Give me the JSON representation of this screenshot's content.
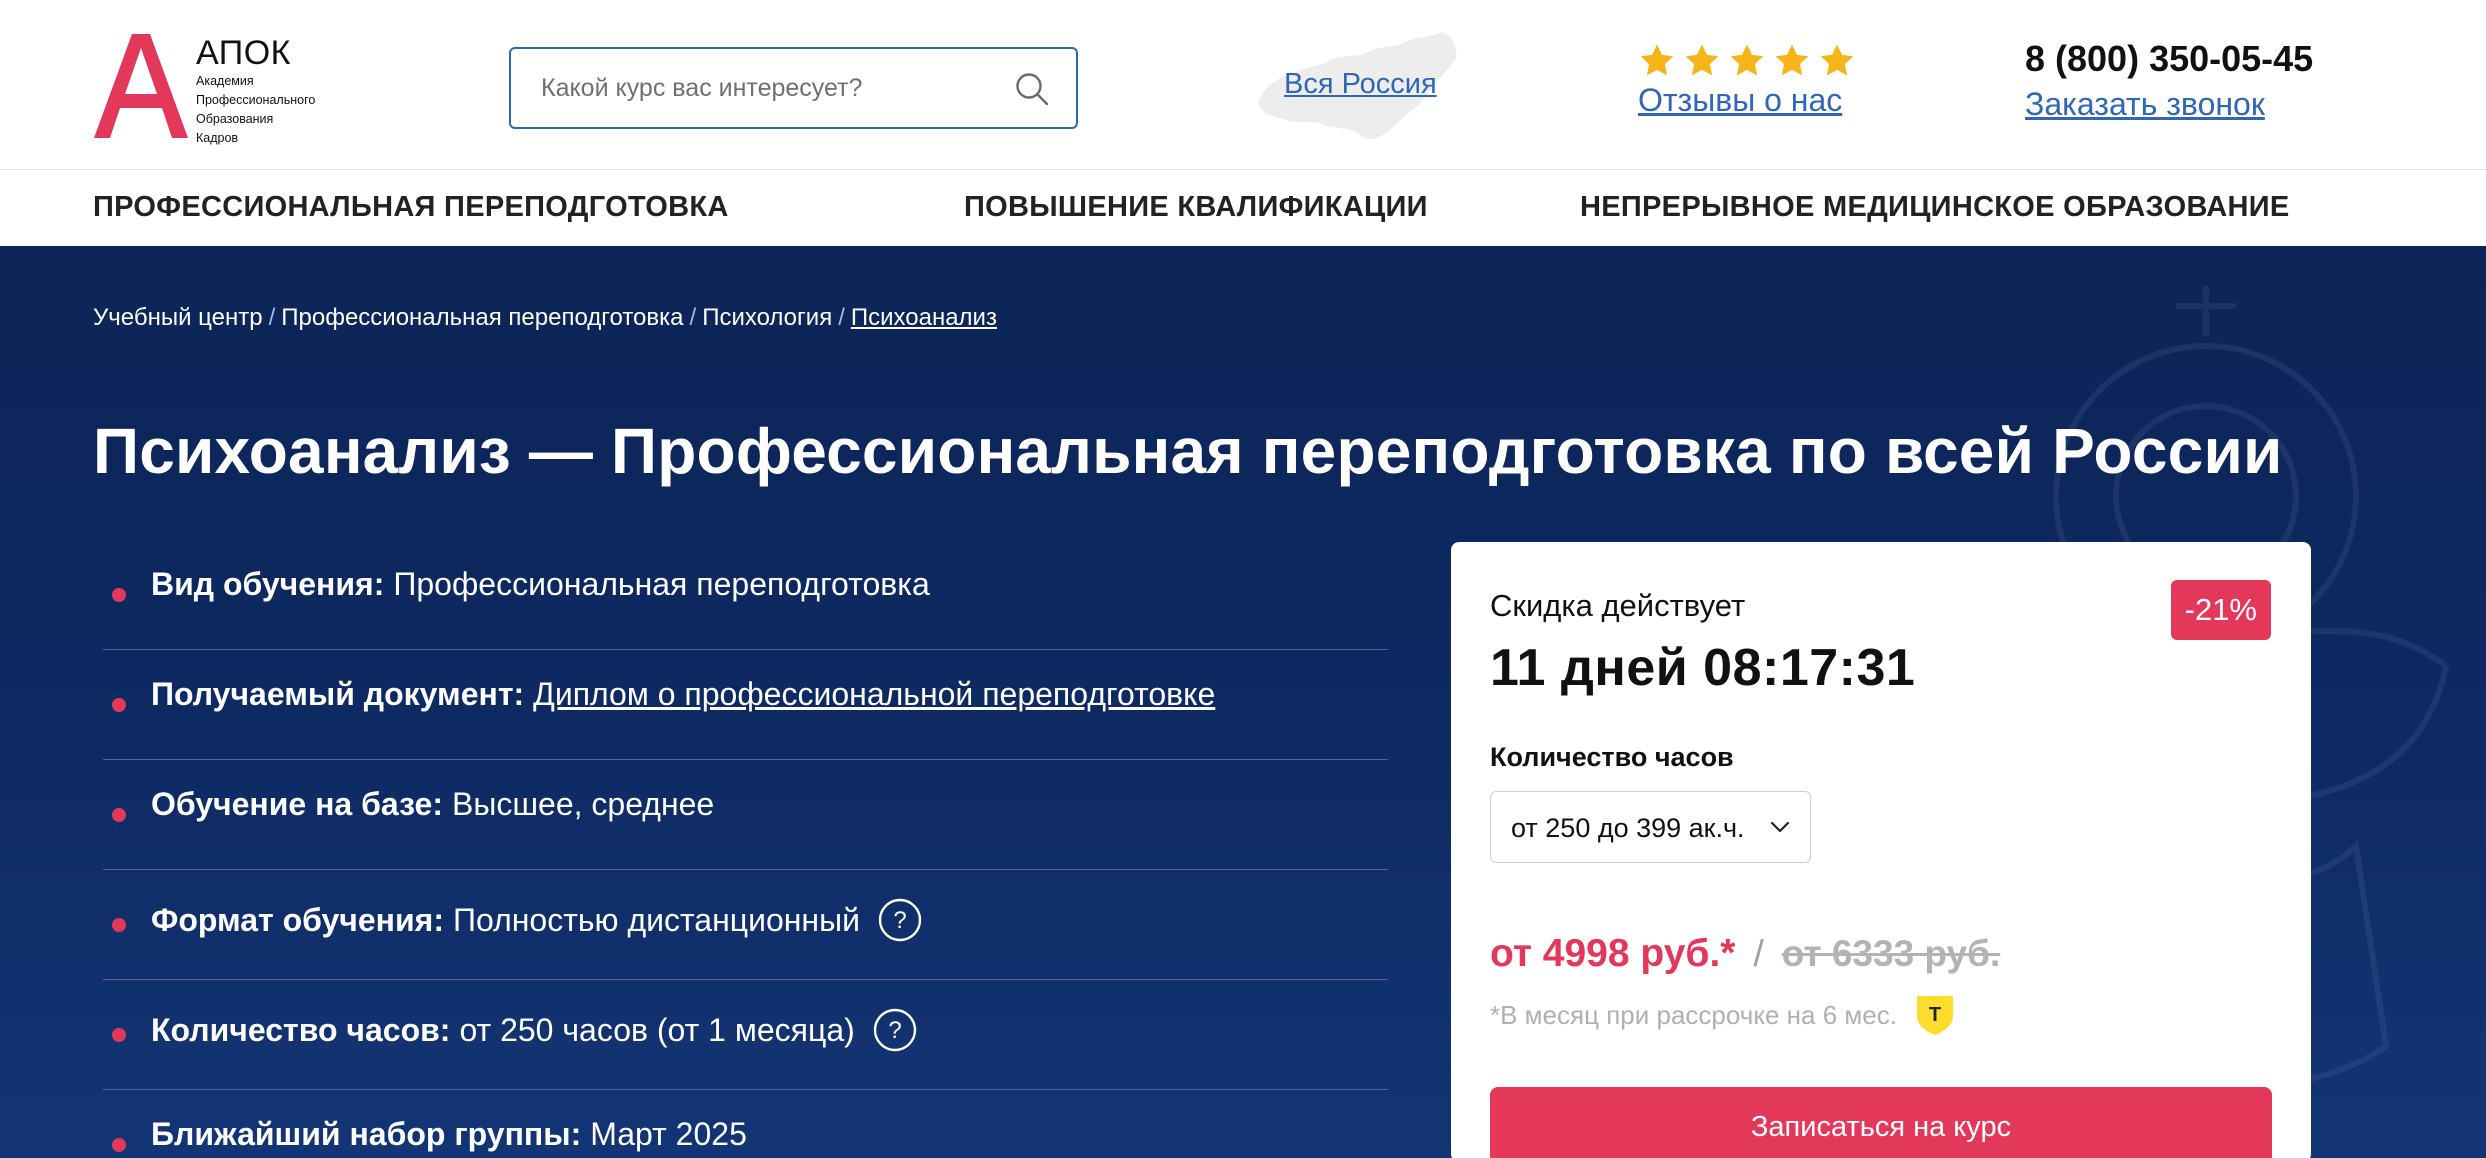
{
  "brand": {
    "name": "АПОК",
    "subtitle_lines": [
      "Академия",
      "Профессионального",
      "Образования",
      "Кадров"
    ],
    "accent_color": "#e3385a",
    "link_color": "#2f66b8"
  },
  "search": {
    "placeholder": "Какой курс вас интересует?",
    "value": ""
  },
  "region": {
    "label": "Вся Россия"
  },
  "reviews": {
    "rating_stars": 5,
    "label": "Отзывы о нас"
  },
  "contacts": {
    "phone": "8 (800) 350-05-45",
    "callback_label": "Заказать звонок"
  },
  "nav": {
    "items": [
      {
        "label": "ПРОФЕССИОНАЛЬНАЯ ПЕРЕПОДГОТОВКА"
      },
      {
        "label": "ПОВЫШЕНИЕ КВАЛИФИКАЦИИ"
      },
      {
        "label": "НЕПРЕРЫВНОЕ МЕДИЦИНСКОЕ ОБРАЗОВАНИЕ"
      }
    ]
  },
  "breadcrumb": {
    "items": [
      "Учебный центр",
      "Профессиональная переподготовка",
      "Психология",
      "Психоанализ"
    ],
    "separator": "/"
  },
  "page": {
    "title": "Психоанализ — Профессиональная переподготовка по всей России"
  },
  "facts": [
    {
      "label": "Вид обучения:",
      "value": "Профессиональная переподготовка",
      "link": false,
      "help": false
    },
    {
      "label": "Получаемый документ:",
      "value": "Диплом о профессиональной переподготовке",
      "link": true,
      "help": false
    },
    {
      "label": "Обучение на базе:",
      "value": "Высшее, среднее",
      "link": false,
      "help": false
    },
    {
      "label": "Формат обучения:",
      "value": "Полностью дистанционный",
      "link": false,
      "help": true
    },
    {
      "label": "Количество часов:",
      "value": "от 250 часов (от 1 месяца)",
      "link": false,
      "help": true
    },
    {
      "label": "Ближайший набор группы:",
      "value": "Март 2025",
      "link": false,
      "help": false
    }
  ],
  "help_icon_glyph": "?",
  "price_card": {
    "discount_label": "Скидка действует",
    "timer": "11 дней 08:17:31",
    "discount_badge": "-21%",
    "hours_label": "Количество часов",
    "hours_selected": "от 250 до 399 ак.ч.",
    "price_new": "от 4998 руб.*",
    "price_separator": "/",
    "price_old": "от 6333 руб.",
    "installment_note": "*В месяц при рассрочке на 6 мес.",
    "installment_badge_letter": "Т",
    "enroll_button": "Записаться на курс"
  }
}
